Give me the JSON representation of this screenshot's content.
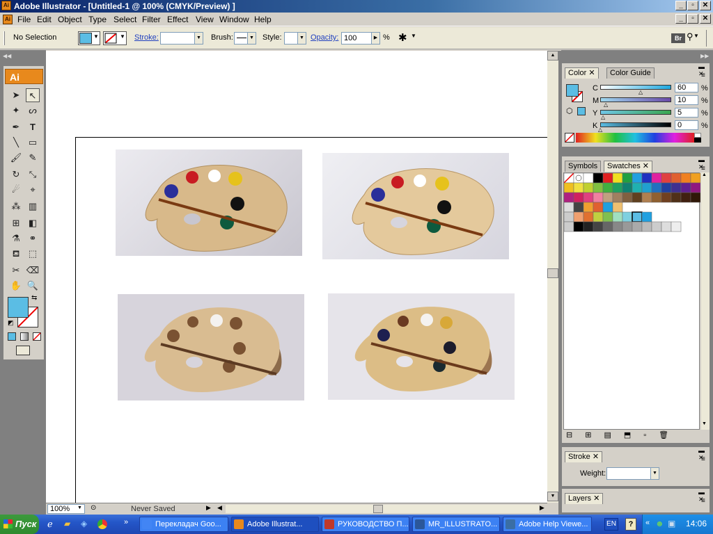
{
  "window": {
    "app_icon": "Ai",
    "title": "Adobe Illustrator - [Untitled-1 @ 100% (CMYK/Preview) ]"
  },
  "menu": [
    "File",
    "Edit",
    "Object",
    "Type",
    "Select",
    "Filter",
    "Effect",
    "View",
    "Window",
    "Help"
  ],
  "control": {
    "selection": "No Selection",
    "stroke_label": "Stroke:",
    "brush_label": "Brush:",
    "style_label": "Style:",
    "opacity_label": "Opacity:",
    "opacity_value": "100",
    "percent": "%",
    "br_label": "Br",
    "fill_color": "#5bbde4"
  },
  "toolbox": {
    "logo": "Ai",
    "icons": [
      "selection-tool-icon",
      "direct-selection-tool-icon",
      "magic-wand-icon",
      "lasso-icon",
      "pen-icon",
      "type-icon",
      "line-icon",
      "rectangle-icon",
      "paintbrush-icon",
      "pencil-icon",
      "rotate-icon",
      "scale-icon",
      "warp-icon",
      "free-transform-icon",
      "symbol-sprayer-icon",
      "column-graph-icon",
      "mesh-icon",
      "gradient-icon",
      "eyedropper-icon",
      "blend-icon",
      "live-paint-bucket-icon",
      "live-paint-selection-icon",
      "slice-icon",
      "eraser-icon",
      "hand-icon",
      "zoom-icon"
    ]
  },
  "color_panel": {
    "tabs": [
      "Color",
      "Color Guide"
    ],
    "channels": [
      {
        "label": "C",
        "value": "60",
        "pct": "%",
        "color": "#1ea8df",
        "level": 0.6
      },
      {
        "label": "M",
        "value": "10",
        "pct": "%",
        "color": "#b02a8a",
        "level": 0.1
      },
      {
        "label": "Y",
        "value": "5",
        "pct": "%",
        "color": "#e6e020",
        "level": 0.05
      },
      {
        "label": "K",
        "value": "0",
        "pct": "%",
        "color": "#000000",
        "level": 0.0
      }
    ]
  },
  "swatches_panel": {
    "tabs": [
      "Symbols",
      "Swatches"
    ]
  },
  "stroke_panel": {
    "tab": "Stroke",
    "weight_label": "Weight:"
  },
  "layers_panel": {
    "tab": "Layers"
  },
  "status": {
    "zoom": "100%",
    "save_state": "Never Saved"
  },
  "taskbar": {
    "start": "Пуск",
    "tasks": [
      {
        "label": "Перекладач Goo...",
        "icon_color": "#4285f4"
      },
      {
        "label": "Adobe Illustrat...",
        "icon_color": "#e8891c"
      },
      {
        "label": "РУКОВОДСТВО П...",
        "icon_color": "#c0392b"
      },
      {
        "label": "MR_ILLUSTRATO...",
        "icon_color": "#2b579a"
      },
      {
        "label": "Adobe Help Viewe...",
        "icon_color": "#3a6ea5"
      }
    ],
    "lang": "EN",
    "help": "?",
    "clock": "14:06"
  }
}
